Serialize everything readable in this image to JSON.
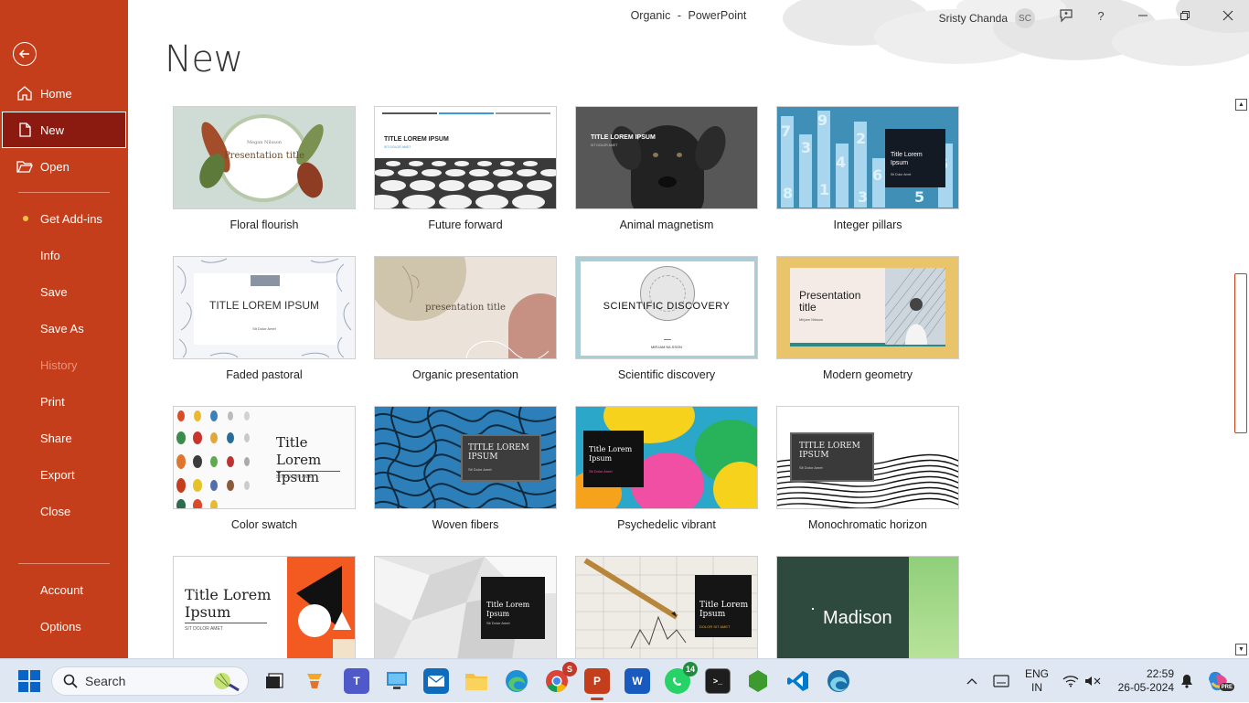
{
  "window": {
    "title_doc": "Organic",
    "title_sep": "-",
    "title_app": "PowerPoint",
    "user_name": "Sristy Chanda",
    "user_initials": "SC",
    "help": "?"
  },
  "sidebar": {
    "items": [
      {
        "label": "Home"
      },
      {
        "label": "New"
      },
      {
        "label": "Open"
      },
      {
        "label": "Get Add-ins"
      },
      {
        "label": "Info"
      },
      {
        "label": "Save"
      },
      {
        "label": "Save As"
      },
      {
        "label": "History"
      },
      {
        "label": "Print"
      },
      {
        "label": "Share"
      },
      {
        "label": "Export"
      },
      {
        "label": "Close"
      },
      {
        "label": "Account"
      },
      {
        "label": "Options"
      }
    ]
  },
  "main": {
    "title": "New",
    "templates": [
      {
        "label": "Floral flourish",
        "t1": "Megan Nilsson",
        "t2": "Presentation title"
      },
      {
        "label": "Future forward",
        "t1": "TITLE LOREM IPSUM",
        "t2": "SIT DOLOR AMET"
      },
      {
        "label": "Animal magnetism",
        "t1": "TITLE LOREM IPSUM",
        "t2": "SIT DOLOR AMET"
      },
      {
        "label": "Integer pillars",
        "t1": "Title Lorem Ipsum",
        "t2": "Sit Dolor Amet"
      },
      {
        "label": "Faded pastoral",
        "t1": "TITLE LOREM IPSUM",
        "t2": "Sit Dolor Amet"
      },
      {
        "label": "Organic presentation",
        "t1": "presentation title"
      },
      {
        "label": "Scientific discovery",
        "t1": "SCIENTIFIC DISCOVERY",
        "t2": "MIRJAM NILSSON"
      },
      {
        "label": "Modern geometry",
        "t1": "Presentation title",
        "t2": "Mirjam Nilsson"
      },
      {
        "label": "Color swatch",
        "t1": "Title Lorem Ipsum",
        "t2": "SIT DOLOR AMET"
      },
      {
        "label": "Woven fibers",
        "t1": "TITLE LOREM IPSUM",
        "t2": "Sit Dolor Amet"
      },
      {
        "label": "Psychedelic vibrant",
        "t1": "Title Lorem Ipsum",
        "t2": "Sit Dolor Amet"
      },
      {
        "label": "Monochromatic horizon",
        "t1": "TITLE LOREM IPSUM",
        "t2": "Sit Dolor Amet"
      },
      {
        "t1": "Title Lorem Ipsum",
        "t2": "SIT DOLOR AMET"
      },
      {
        "t1": "Title Lorem Ipsum",
        "t2": "Sit Dolor Amet"
      },
      {
        "t1": "Title Lorem Ipsum",
        "t2": "DOLOR SIT AMET"
      },
      {
        "t1": "Madison"
      }
    ]
  },
  "taskbar": {
    "search_placeholder": "Search",
    "chrome_badge": "S",
    "whatsapp_badge": "14",
    "lang_1": "ENG",
    "lang_2": "IN",
    "time": "22:59",
    "date": "26-05-2024",
    "copilot_badge": "PRE"
  },
  "colors": {
    "accent": "#c43e1c",
    "selected": "#8b1a10",
    "disabled": "#e69480"
  }
}
